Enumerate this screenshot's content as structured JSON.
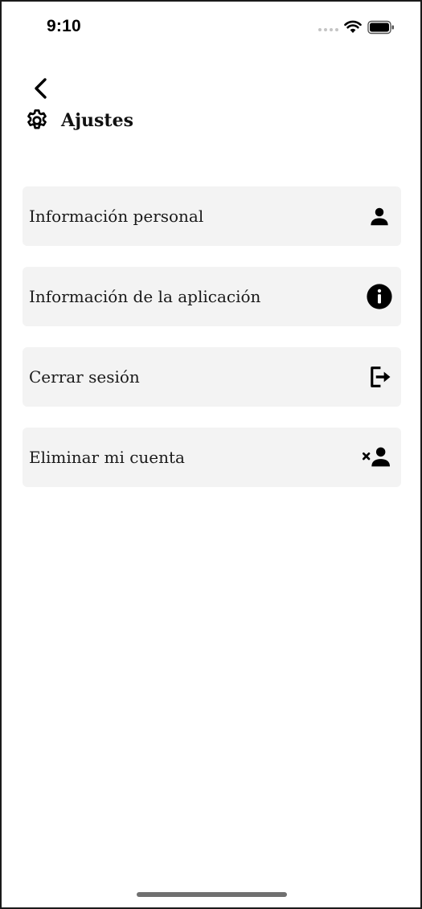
{
  "status_bar": {
    "time": "9:10"
  },
  "header": {
    "title": "Ajustes",
    "back_icon": "chevron-left-icon",
    "title_icon": "gear-icon"
  },
  "settings": {
    "items": [
      {
        "label": "Información personal",
        "icon": "person-icon"
      },
      {
        "label": "Información de la aplicación",
        "icon": "info-icon"
      },
      {
        "label": "Cerrar sesión",
        "icon": "logout-icon"
      },
      {
        "label": "Eliminar mi cuenta",
        "icon": "remove-user-icon"
      }
    ]
  },
  "colors": {
    "item_background": "#f3f3f3",
    "text": "#111111",
    "home_indicator": "#707070"
  }
}
